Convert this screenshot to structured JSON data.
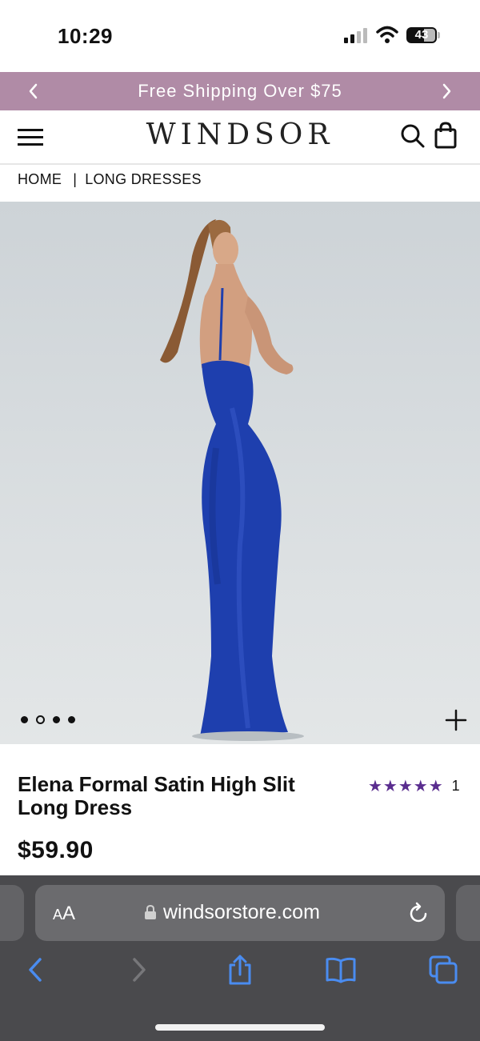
{
  "status_bar": {
    "time": "10:29",
    "battery": "43"
  },
  "promo": {
    "text": "Free Shipping Over $75",
    "prev_icon": "chevron-left-icon",
    "next_icon": "chevron-right-icon"
  },
  "header": {
    "brand": "WINDSOR",
    "menu_icon": "hamburger-icon",
    "search_icon": "search-icon",
    "bag_icon": "shopping-bag-icon"
  },
  "breadcrumb": [
    {
      "label": "HOME"
    },
    {
      "label": "LONG DRESSES"
    }
  ],
  "breadcrumb_separator": "|",
  "gallery": {
    "image_count": 4,
    "active_index": 1,
    "zoom_icon": "plus-icon"
  },
  "product": {
    "title": "Elena Formal Satin High Slit Long Dress",
    "price": "$59.90",
    "rating_stars": "★★★★★",
    "rating_value": 5,
    "rating_count": "1"
  },
  "browser": {
    "text_size_label_small": "A",
    "text_size_label_large": "A",
    "url": "windsorstore.com",
    "icons": [
      "back-icon",
      "forward-icon",
      "share-icon",
      "bookmarks-icon",
      "tabs-icon",
      "reload-icon",
      "lock-icon"
    ]
  },
  "colors": {
    "promo_bg": "#b08ba6",
    "star": "#5a2d8f",
    "dress": "#1e3fae",
    "browser_bg": "#4a4a4d",
    "toolbar_icon": "#4a8cf0"
  }
}
